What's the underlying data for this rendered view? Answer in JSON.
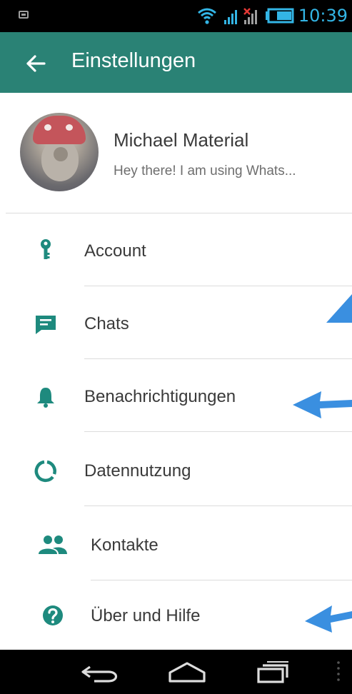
{
  "status_bar": {
    "time": "10:39",
    "accent_color": "#33b5e5"
  },
  "app_bar": {
    "title": "Einstellungen",
    "back_icon": "arrow-back-icon",
    "color": "#2a8275"
  },
  "profile": {
    "name": "Michael Material",
    "status": "Hey there! I am using Whats..."
  },
  "settings": {
    "accent_color": "#1e8a7e",
    "items": [
      {
        "label": "Account",
        "icon": "key-icon"
      },
      {
        "label": "Chats",
        "icon": "chat-icon"
      },
      {
        "label": "Benachrichtigungen",
        "icon": "bell-icon"
      },
      {
        "label": "Datennutzung",
        "icon": "data-usage-icon"
      },
      {
        "label": "Kontakte",
        "icon": "contacts-icon"
      },
      {
        "label": "Über und Hilfe",
        "icon": "help-icon"
      }
    ]
  },
  "annotations": {
    "arrow_color": "#3a8fe0"
  }
}
